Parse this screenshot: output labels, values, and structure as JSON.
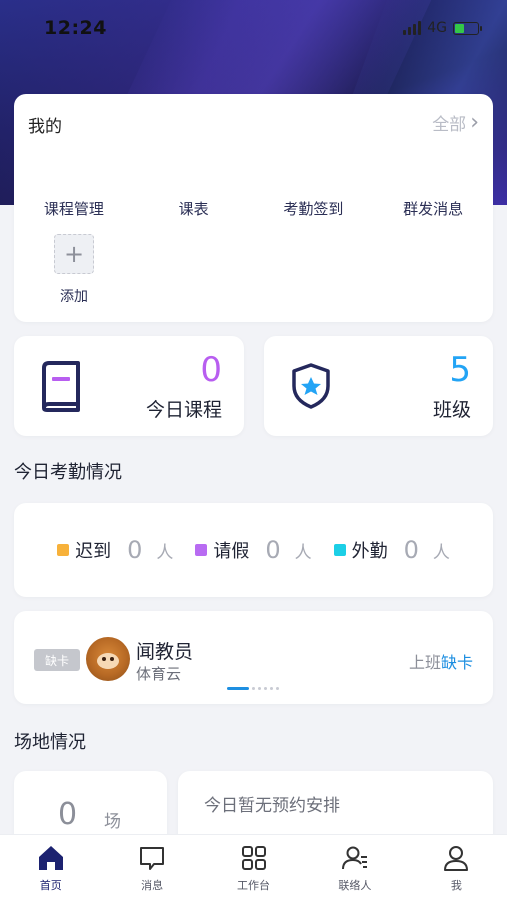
{
  "status_bar": {
    "time": "12:24",
    "network": "4G"
  },
  "my_section": {
    "title": "我的",
    "all_label": "全部",
    "shortcuts": [
      "课程管理",
      "课表",
      "考勤签到",
      "群发消息"
    ],
    "add_label": "添加"
  },
  "stats": {
    "courses": {
      "value": "0",
      "label": "今日课程",
      "color": "#b85ef0"
    },
    "classes": {
      "value": "5",
      "label": "班级",
      "color": "#23a4f5"
    }
  },
  "attendance": {
    "title": "今日考勤情况",
    "items": [
      {
        "name": "迟到",
        "count": "0",
        "unit": "人",
        "color": "#f7b13a"
      },
      {
        "name": "请假",
        "count": "0",
        "unit": "人",
        "color": "#b86bf2"
      },
      {
        "name": "外勤",
        "count": "0",
        "unit": "人",
        "color": "#1ccfe6"
      }
    ]
  },
  "person": {
    "tag": "缺卡",
    "name": "闻教员",
    "org": "体育云",
    "shift_label": "上班",
    "shift_status": "缺卡"
  },
  "venue": {
    "title": "场地情况",
    "count": "0",
    "unit": "场",
    "empty_text": "今日暂无预约安排"
  },
  "tabbar": {
    "tabs": [
      {
        "label": "首页",
        "icon": "home-icon"
      },
      {
        "label": "消息",
        "icon": "message-icon"
      },
      {
        "label": "工作台",
        "icon": "grid-icon"
      },
      {
        "label": "联络人",
        "icon": "contacts-icon"
      },
      {
        "label": "我",
        "icon": "user-icon"
      }
    ]
  },
  "colors": {
    "accent": "#1e8fe1",
    "brand_dark": "#1c2270"
  }
}
